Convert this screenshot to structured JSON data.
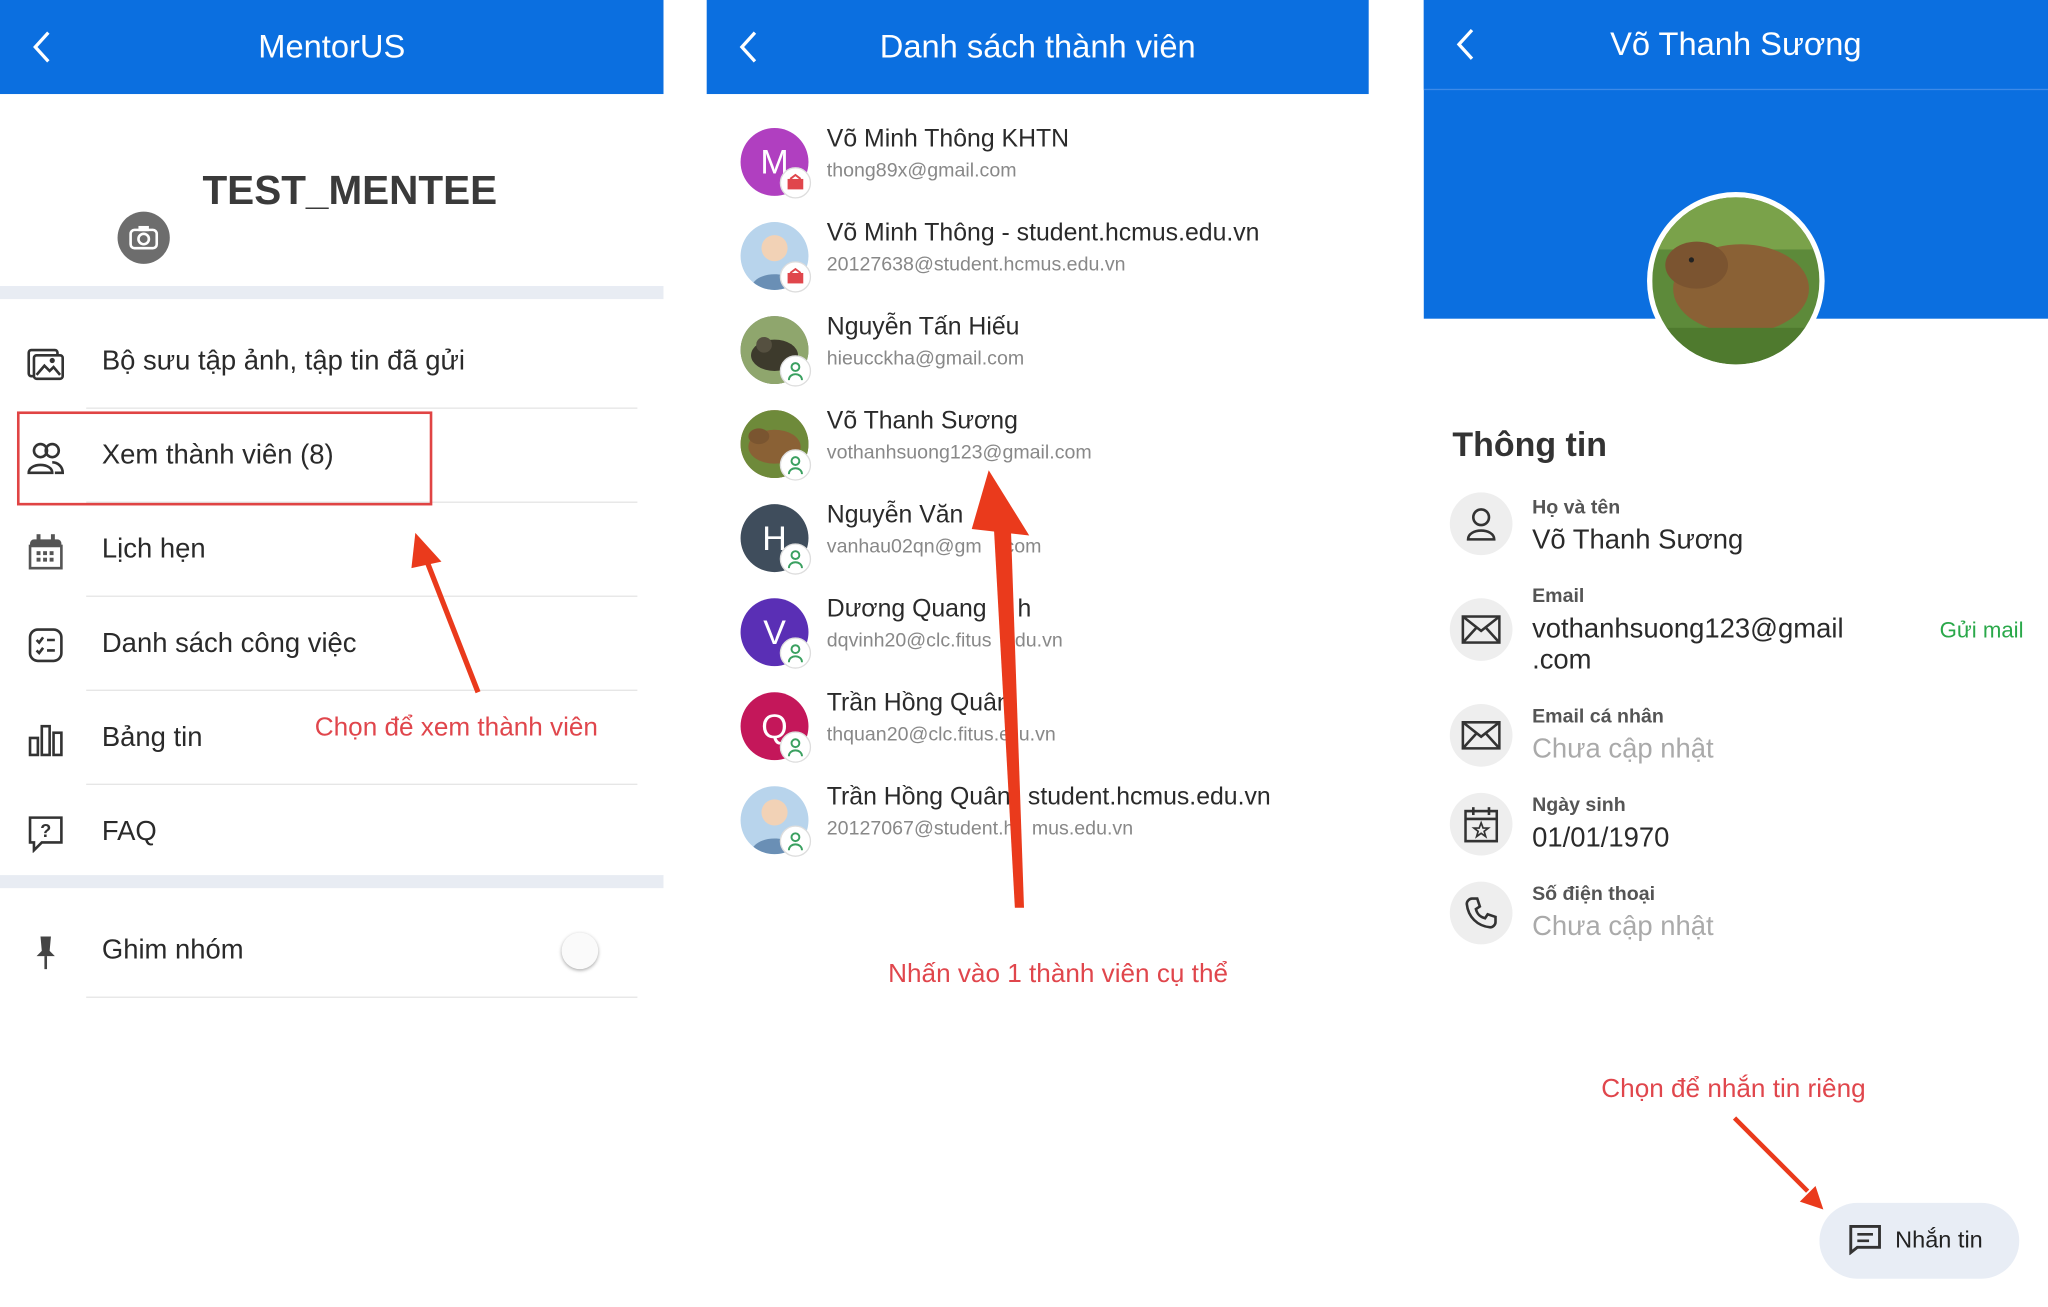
{
  "colors": {
    "primary": "#0b6fe0",
    "annotation": "#e0464c",
    "arrow": "#ea3a1c",
    "link_green": "#2aa84a"
  },
  "panel1": {
    "title": "MentorUS",
    "group_name": "TEST_MENTEE",
    "menu": [
      {
        "icon": "gallery-icon",
        "label": "Bộ sưu tập ảnh, tập tin đã gửi"
      },
      {
        "icon": "members-icon",
        "label": "Xem thành viên (8)"
      },
      {
        "icon": "calendar-icon",
        "label": "Lịch hẹn"
      },
      {
        "icon": "checklist-icon",
        "label": "Danh sách công việc"
      },
      {
        "icon": "chart-icon",
        "label": "Bảng tin"
      },
      {
        "icon": "faq-icon",
        "label": "FAQ"
      }
    ],
    "pin": {
      "icon": "pin-icon",
      "label": "Ghim nhóm",
      "enabled": false
    },
    "annotation": "Chọn để xem thành viên"
  },
  "panel2": {
    "title": "Danh sách thành viên",
    "members": [
      {
        "initial": "M",
        "name": "Võ Minh Thông KHTN",
        "email": "thong89x@gmail.com",
        "avatar_color": "#b03fc0",
        "badge": "mentor-badge-icon"
      },
      {
        "initial": "",
        "name": "Võ Minh Thông - student.hcmus.edu.vn",
        "email": "20127638@student.hcmus.edu.vn",
        "avatar_color": "#b8d4ec",
        "badge": "mentor-badge-icon"
      },
      {
        "initial": "",
        "name": "Nguyễn Tấn Hiếu",
        "email": "hieucckha@gmail.com",
        "avatar_color": "#6d7b5a",
        "badge": "mentee-badge-icon"
      },
      {
        "initial": "",
        "name": "Võ Thanh Sương",
        "email": "vothanhsuong123@gmail.com",
        "avatar_color": "#8a6a3c",
        "badge": "mentee-badge-icon"
      },
      {
        "initial": "H",
        "name": "Nguyễn Văn",
        "email": "vanhau02qn@gm",
        "email_tail": "com",
        "avatar_color": "#3f4d5c",
        "badge": "mentee-badge-icon"
      },
      {
        "initial": "V",
        "name": "Dương Quang",
        "name_tail": "h",
        "email": "dqvinh20@clc.fitus",
        "email_tail": "du.vn",
        "avatar_color": "#5a2fb5",
        "badge": "mentee-badge-icon"
      },
      {
        "initial": "Q",
        "name": "Trần Hồng Quân",
        "email": "thquan20@clc.fitus.e",
        "email_tail": "u.vn",
        "avatar_color": "#c4175a",
        "badge": "mentee-badge-icon"
      },
      {
        "initial": "",
        "name": "Trần Hồng Quân",
        "name_tail": "student.hcmus.edu.vn",
        "email": "20127067@student.h",
        "email_tail": "mus.edu.vn",
        "avatar_color": "#b8d4ec",
        "badge": "mentee-badge-icon"
      }
    ],
    "annotation": "Nhấn vào 1 thành viên cụ thể"
  },
  "panel3": {
    "title": "Võ Thanh Sương",
    "section_title": "Thông tin",
    "fields": [
      {
        "icon": "person-icon",
        "label": "Họ và tên",
        "value": "Võ Thanh Sương",
        "placeholder": false
      },
      {
        "icon": "mail-icon",
        "label": "Email",
        "value": "vothanhsuong123@gmail",
        "value2": ".com",
        "placeholder": false,
        "action": "Gửi mail"
      },
      {
        "icon": "mail-icon",
        "label": "Email cá nhân",
        "value": "Chưa cập nhật",
        "placeholder": true
      },
      {
        "icon": "birthday-calendar-icon",
        "label": "Ngày sinh",
        "value": "01/01/1970",
        "placeholder": false
      },
      {
        "icon": "phone-icon",
        "label": "Số điện thoại",
        "value": "Chưa cập nhật",
        "placeholder": true
      }
    ],
    "message_button": {
      "icon": "message-icon",
      "label": "Nhắn tin"
    },
    "annotation": "Chọn để nhắn tin riêng"
  }
}
